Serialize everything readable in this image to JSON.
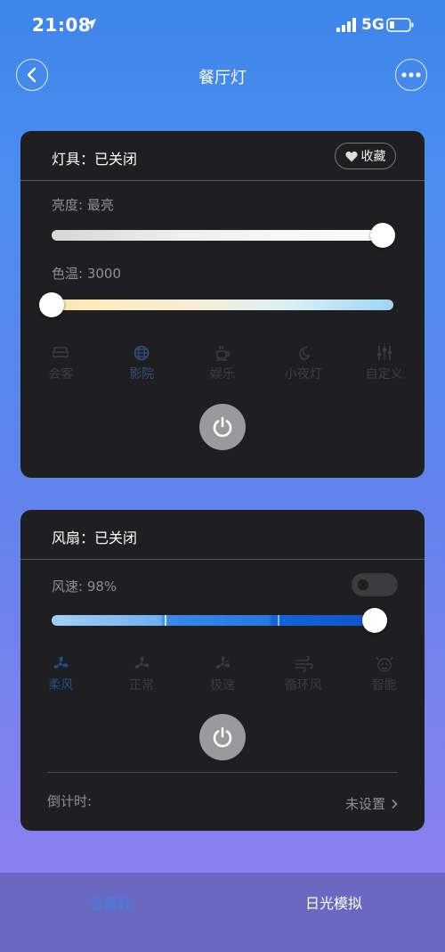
{
  "status": {
    "time": "21:08",
    "network": "5G"
  },
  "nav": {
    "title": "餐厅灯"
  },
  "light": {
    "title": "灯具：已关闭",
    "favorite_label": "收藏",
    "brightness_label": "亮度: 最亮",
    "brightness_level": 1.0,
    "color_temp_label": "色温: 3000",
    "color_temp_level": 0.0,
    "modes": [
      {
        "label": "会客",
        "icon": "sofa-icon",
        "active": false
      },
      {
        "label": "影院",
        "icon": "globe-icon",
        "active": true
      },
      {
        "label": "娱乐",
        "icon": "coffee-icon",
        "active": false
      },
      {
        "label": "小夜灯",
        "icon": "moon-icon",
        "active": false
      },
      {
        "label": "自定义",
        "icon": "sliders-icon",
        "active": false
      }
    ]
  },
  "fan": {
    "title": "风扇：已关闭",
    "speed_label": "风速: 98%",
    "speed_level": 0.98,
    "modes": [
      {
        "label": "柔风",
        "icon": "fan-icon",
        "active": true
      },
      {
        "label": "正常",
        "icon": "fan-icon",
        "active": false
      },
      {
        "label": "极速",
        "icon": "fan-icon",
        "active": false
      },
      {
        "label": "循环风",
        "icon": "wind-icon",
        "active": false
      },
      {
        "label": "智能",
        "icon": "smart-icon",
        "active": false
      }
    ],
    "timer_label": "倒计时:",
    "timer_value": "未设置"
  },
  "tabs": [
    {
      "label": "全屋控",
      "active": true
    },
    {
      "label": "日光模拟",
      "active": false
    }
  ],
  "colors": {
    "accent": "#3f82e6",
    "card_bg": "#1f1f21",
    "speed_gradient_start": "#a4cff5",
    "speed_gradient_end": "#1565d8"
  }
}
